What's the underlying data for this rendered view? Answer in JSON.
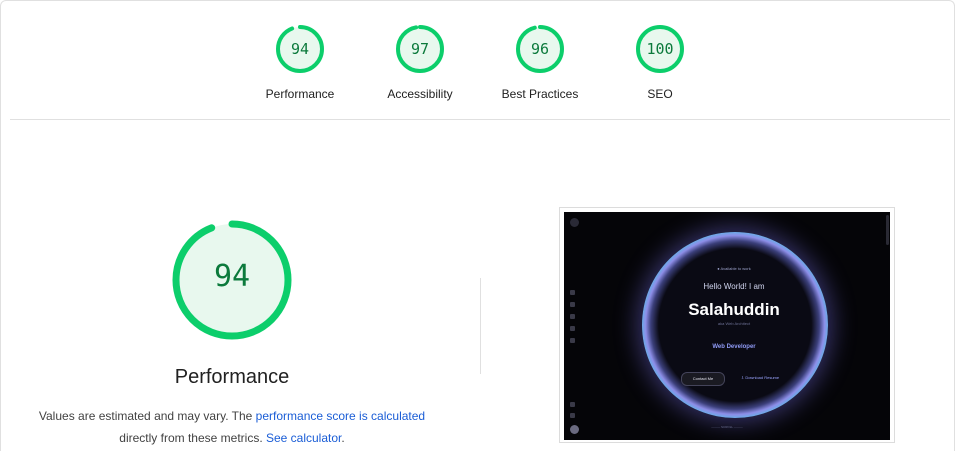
{
  "categories": [
    {
      "label": "Performance",
      "score": "94",
      "fraction": 0.94
    },
    {
      "label": "Accessibility",
      "score": "97",
      "fraction": 0.97
    },
    {
      "label": "Best Practices",
      "score": "96",
      "fraction": 0.96
    },
    {
      "label": "SEO",
      "score": "100",
      "fraction": 1.0
    }
  ],
  "main": {
    "score": "94",
    "fraction": 0.94,
    "title": "Performance",
    "desc_part1": "Values are estimated and may vary. The ",
    "desc_link1": "performance score is calculated",
    "desc_part2": "directly from these metrics. ",
    "desc_link2": "See calculator",
    "desc_end": "."
  },
  "screenshot": {
    "available": "● Available to work",
    "hello": "Hello World! I am",
    "name": "Salahuddin",
    "subtitle": "aka Web Architect",
    "role": "Web Developer",
    "contact_button": "Contact Me",
    "download_button": "⇩ Download Resume",
    "scroll": "——— SCROLL ———"
  },
  "colors": {
    "pass_green": "#0cce6b",
    "pass_fill": "#e8f8ee",
    "score_text": "#0c7a3c",
    "link": "#1a5dd6"
  }
}
